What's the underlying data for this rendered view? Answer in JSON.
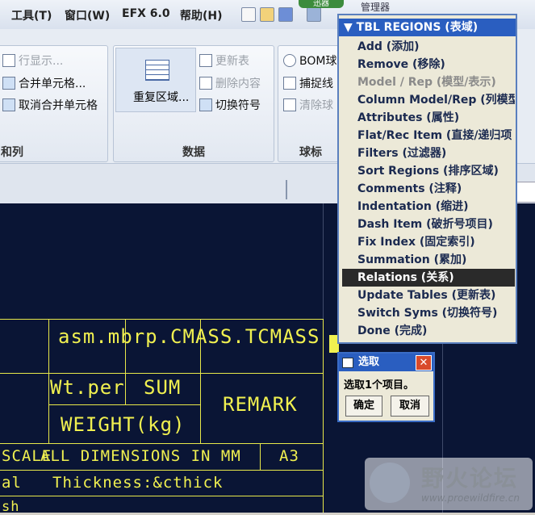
{
  "menubar": {
    "items": [
      "工具(T)",
      "窗口(W)",
      "EFX 6.0",
      "帮助(H)"
    ],
    "partial_title": "管理器",
    "partial_tab": "迅器"
  },
  "ribbon": {
    "group1": {
      "items": [
        "行显示...",
        "合并单元格...",
        "取消合并单元格"
      ],
      "caption": "和列"
    },
    "group2": {
      "big_button": "重复区域...",
      "items": [
        "更新表",
        "删除内容",
        "切换符号"
      ],
      "caption": "数据"
    },
    "group3": {
      "items": [
        "BOM球",
        "捕捉线",
        "清除球"
      ],
      "caption": "球标"
    }
  },
  "drawing": {
    "labels": {
      "asm": "asm.mbrp.CMASS.TCMASS",
      "wtper": "Wt.per",
      "sum": "SUM",
      "remark": "REMARK",
      "weight": "WEIGHT(kg)",
      "scale": "SCALE",
      "dimensions": "ALL DIMENSIONS IN MM",
      "a3": "A3",
      "al": "al",
      "thickness": "Thickness:&cthick",
      "sh": "sh"
    },
    "colors": {
      "background": "#0a1535",
      "lines": "#e8e84a"
    }
  },
  "menu_manager": {
    "header": "TBL REGIONS (表域)",
    "items": [
      {
        "label": "Add (添加)",
        "state": "normal"
      },
      {
        "label": "Remove (移除)",
        "state": "normal"
      },
      {
        "label": "Model / Rep (模型/表示)",
        "state": "disabled"
      },
      {
        "label": "Column Model/Rep (列模型",
        "state": "normal"
      },
      {
        "label": "Attributes (属性)",
        "state": "normal"
      },
      {
        "label": "Flat/Rec Item (直接/递归项",
        "state": "normal"
      },
      {
        "label": "Filters (过滤器)",
        "state": "normal"
      },
      {
        "label": "Sort Regions (排序区域)",
        "state": "normal"
      },
      {
        "label": "Comments (注释)",
        "state": "normal"
      },
      {
        "label": "Indentation (缩进)",
        "state": "normal"
      },
      {
        "label": "Dash Item (破折号项目)",
        "state": "normal"
      },
      {
        "label": "Fix Index (固定索引)",
        "state": "normal"
      },
      {
        "label": "Summation (累加)",
        "state": "normal"
      },
      {
        "label": "Relations (关系)",
        "state": "selected"
      },
      {
        "label": "Update Tables (更新表)",
        "state": "normal"
      },
      {
        "label": "Switch Syms (切换符号)",
        "state": "normal"
      },
      {
        "label": "Done (完成)",
        "state": "normal"
      }
    ]
  },
  "select_dialog": {
    "title": "选取",
    "message": "选取1个项目。",
    "ok": "确定",
    "cancel": "取消"
  },
  "watermark": {
    "title": "野火论坛",
    "url": "www.proewildfire.cn"
  }
}
